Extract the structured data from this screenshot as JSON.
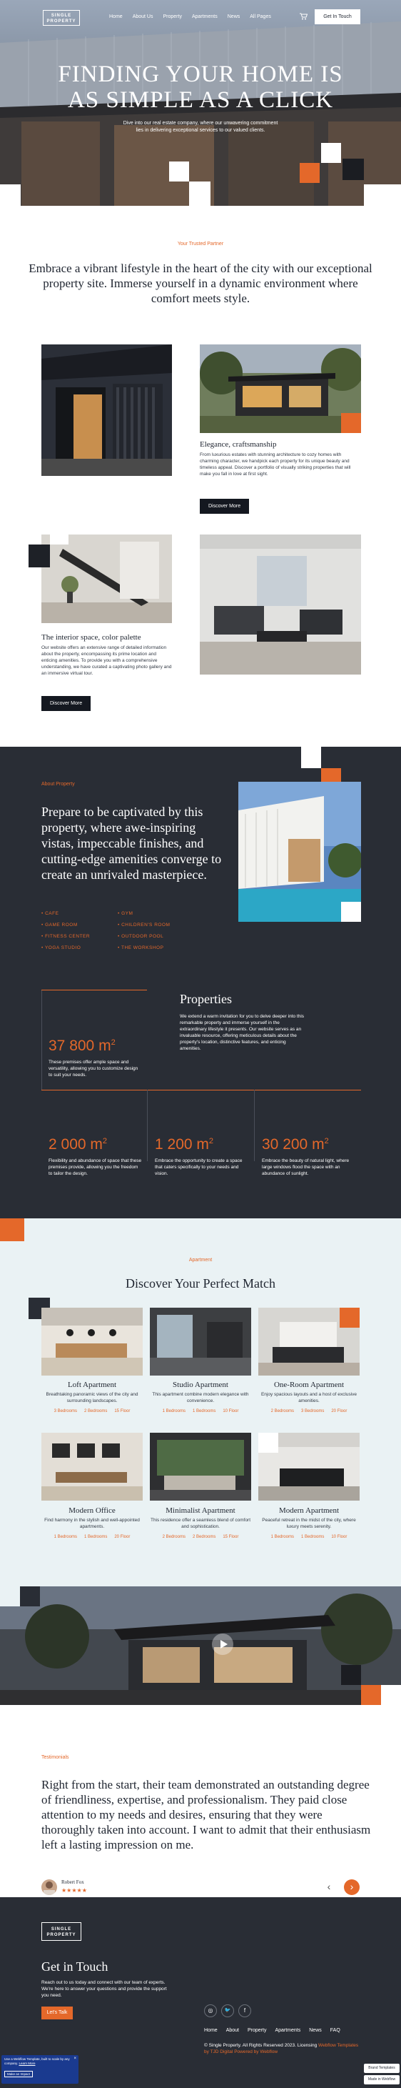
{
  "nav": {
    "logo_line1": "SINGLE",
    "logo_line2": "PROPERTY",
    "links": [
      "Home",
      "About Us",
      "Property",
      "Apartments",
      "News",
      "All Pages"
    ],
    "cta": "Get In Touch"
  },
  "hero": {
    "title_line1": "FINDING YOUR HOME IS",
    "title_line2": "AS SIMPLE AS A CLICK",
    "subtitle": "Dive into our real estate company, where our unwavering commitment lies in delivering exceptional services to our valued clients."
  },
  "intro": {
    "kicker": "Your Trusted Partner",
    "text": "Embrace a vibrant lifestyle in the heart of the city with our exceptional property site. Immerse yourself in a dynamic environment where comfort meets style."
  },
  "features": [
    {
      "title": "Elegance, craftsmanship",
      "text": "From luxurious estates with stunning architecture to cozy homes with charming character, we handpick each property for its unique beauty and timeless appeal. Discover a portfolio of visually striking properties that will make you fall in love at first sight.",
      "button": "Discover More"
    },
    {
      "title": "The interior space, color palette",
      "text": "Our website offers an extensive range of detailed information about the property, encompassing its prime location and enticing amenities. To provide you with a comprehensive understanding, we have curated a captivating photo gallery and an immersive virtual tour.",
      "button": "Discover More"
    }
  ],
  "about": {
    "kicker": "About Property",
    "heading": "Prepare to be captivated by this property, where awe-inspiring vistas, impeccable finishes, and cutting-edge amenities converge to create an unrivaled masterpiece.",
    "amenities_left": [
      "CAFE",
      "GAME ROOM",
      "FITNESS CENTER",
      "YOGA STUDIO"
    ],
    "amenities_right": [
      "GYM",
      "CHILDREN'S ROOM",
      "OUTDOOR POOL",
      "THE WORKSHOP"
    ],
    "properties_title": "Properties",
    "properties_text": "We extend a warm invitation for you to delve deeper into this remarkable property and immerse yourself in the extraordinary lifestyle it presents. Our website serves as an invaluable resource, offering meticulous details about the property's location, distinctive features, and enticing amenities.",
    "stats": [
      {
        "value": "37 800 m",
        "sup": "2",
        "text": "These premises offer ample space and versatility, allowing you to customize design to suit your needs."
      },
      {
        "value": "2 000 m",
        "sup": "2",
        "text": "Flexibility and abundance of space that these premises provide, allowing you the freedom to tailor the design."
      },
      {
        "value": "1 200 m",
        "sup": "2",
        "text": "Embrace the opportunity to create a space that caters specifically to your needs and vision."
      },
      {
        "value": "30 200 m",
        "sup": "2",
        "text": "Embrace the beauty of natural light, where large windows flood the space with an abundance of sunlight."
      }
    ]
  },
  "apartments": {
    "kicker": "Apartment",
    "title": "Discover Your Perfect Match",
    "items": [
      {
        "title": "Loft Apartment",
        "desc": "Breathtaking panoramic views of the city and surrounding landscapes.",
        "meta": [
          "3 Bedrooms",
          "2 Bedrooms",
          "15 Floor"
        ]
      },
      {
        "title": "Studio Apartment",
        "desc": "This apartment combine modern elegance with convenience.",
        "meta": [
          "1 Bedrooms",
          "1 Bedrooms",
          "10 Floor"
        ]
      },
      {
        "title": "One-Room Apartment",
        "desc": "Enjoy spacious layouts and a host of exclusive amenities.",
        "meta": [
          "2 Bedrooms",
          "3 Bedrooms",
          "20 Floor"
        ]
      },
      {
        "title": "Modern Office",
        "desc": "Find harmony in the stylish and well-appointed apartments.",
        "meta": [
          "1 Bedrooms",
          "1 Bedrooms",
          "20 Floor"
        ]
      },
      {
        "title": "Minimalist Apartment",
        "desc": "This residence offer a seamless blend of comfort and sophistication.",
        "meta": [
          "2 Bedrooms",
          "2 Bedrooms",
          "15 Floor"
        ]
      },
      {
        "title": "Modern Apartment",
        "desc": "Peaceful retreat in the midst of the city, where luxury meets serenity.",
        "meta": [
          "1 Bedrooms",
          "1 Bedrooms",
          "10 Floor"
        ]
      }
    ]
  },
  "testimonial": {
    "kicker": "Testimonials",
    "quote": "Right from the start, their team demonstrated an outstanding degree of friendliness, expertise, and professionalism. They paid close attention to my needs and desires, ensuring that they were thoroughly taken into account. I want to admit that their enthusiasm left a lasting impression on me.",
    "author": "Robert Fox",
    "stars": "★★★★★",
    "prev": "‹",
    "next": "›"
  },
  "footer": {
    "logo_line1": "SINGLE",
    "logo_line2": "PROPERTY",
    "title": "Get in Touch",
    "text": "Reach out to us today and connect with our team of experts. We're here to answer your questions and provide the support you need.",
    "cta": "Let's Talk",
    "social": [
      "◎",
      "🐦",
      "f"
    ],
    "links": [
      "Home",
      "About",
      "Property",
      "Apartments",
      "News",
      "FAQ"
    ],
    "copyright": "© Single Property. All Rights Reserved 2023. Licensing",
    "credit_text": "Webflow Templates by",
    "credit_brand": "TJD Digital",
    "powered": "Powered by Webflow"
  },
  "badge": {
    "line1": "Use a Webflow Template, built to scale by",
    "line2": "any company.",
    "link": "Learn More",
    "button": "Make an Impact",
    "sub": "Brand Templates",
    "sub2": "Made in Webflow"
  },
  "colors": {
    "accent": "#e4682a",
    "dark": "#292d35",
    "light": "#eaf2f4"
  }
}
